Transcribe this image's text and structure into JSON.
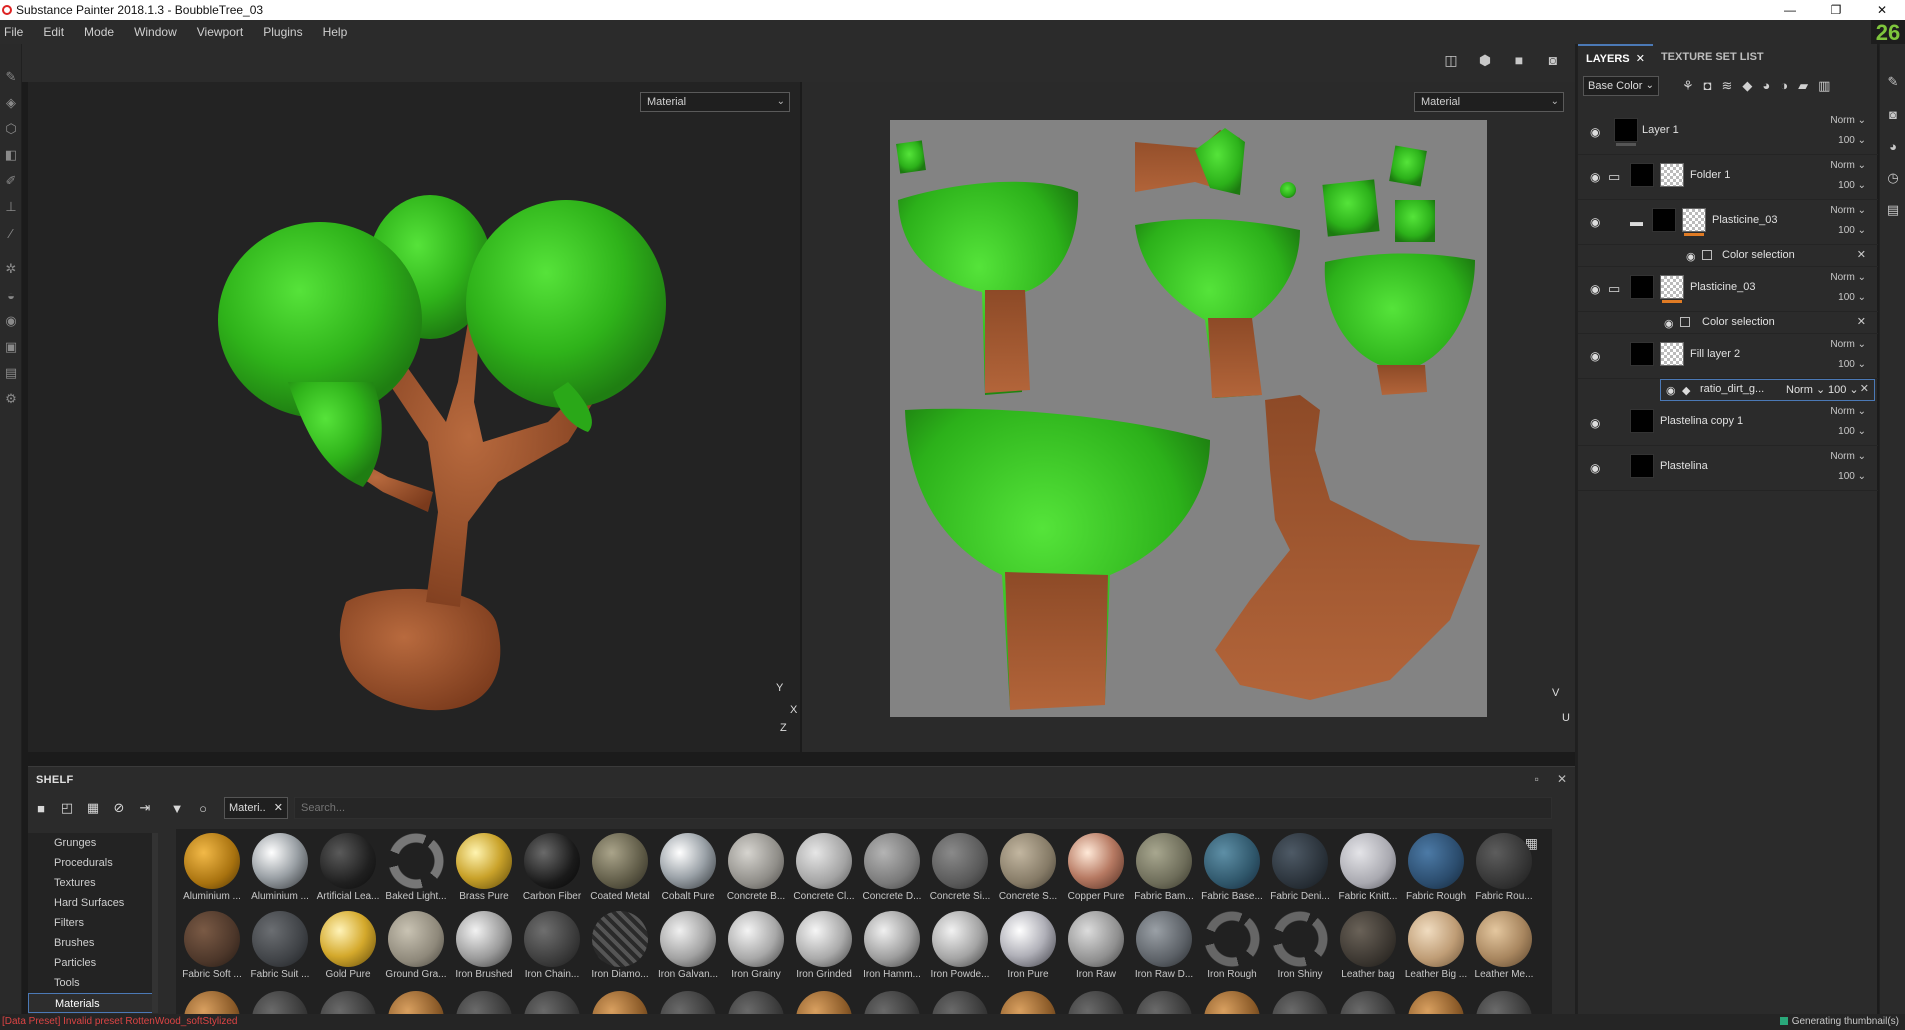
{
  "window": {
    "title": "Substance Painter 2018.1.3 - BoubbleTree_03",
    "controls": [
      "—",
      "❐",
      "✕"
    ]
  },
  "menu": {
    "items": [
      "File",
      "Edit",
      "Mode",
      "Window",
      "Viewport",
      "Plugins",
      "Help"
    ],
    "counter": "26"
  },
  "viewport": {
    "left_select": "Material",
    "right_select": "Material",
    "axis3d": {
      "y": "Y",
      "x": "X",
      "z": "Z"
    },
    "axis2d": {
      "v": "V",
      "u": "U"
    }
  },
  "shelf": {
    "title": "SHELF",
    "filter_chip": "Materi..",
    "filter_close": "✕",
    "search_placeholder": "Search...",
    "categories": [
      "Grunges",
      "Procedurals",
      "Textures",
      "Hard Surfaces",
      "Filters",
      "Brushes",
      "Particles",
      "Tools",
      "Materials"
    ],
    "active_category": "Materials",
    "materials_row1": [
      "Aluminium ...",
      "Aluminium ...",
      "Artificial Lea...",
      "Baked Light...",
      "Brass Pure",
      "Carbon Fiber",
      "Coated Metal",
      "Cobalt Pure",
      "Concrete B...",
      "Concrete Cl...",
      "Concrete D...",
      "Concrete Si...",
      "Concrete S...",
      "Copper Pure",
      "Fabric Bam...",
      "Fabric Base...",
      "Fabric Deni...",
      "Fabric Knitt...",
      "Fabric Rough",
      "Fabric Rou..."
    ],
    "materials_row2": [
      "Fabric Soft ...",
      "Fabric Suit ...",
      "Gold Pure",
      "Ground Gra...",
      "Iron Brushed",
      "Iron Chain...",
      "Iron Diamo...",
      "Iron Galvan...",
      "Iron Grainy",
      "Iron Grinded",
      "Iron Hamm...",
      "Iron Powde...",
      "Iron Pure",
      "Iron Raw",
      "Iron Raw D...",
      "Iron Rough",
      "Iron Shiny",
      "Leather bag",
      "Leather Big ...",
      "Leather Me..."
    ]
  },
  "status": {
    "error": "[Data Preset] Invalid preset RottenWood_softStylized",
    "right": "Generating thumbnail(s)"
  },
  "layers_panel": {
    "tab_layers": "LAYERS",
    "tab_close": "✕",
    "tab_texture_set": "TEXTURE SET LIST",
    "channel": "Base Color",
    "layers": [
      {
        "name": "Layer 1",
        "blend": "Norm",
        "opacity": "100"
      },
      {
        "name": "Folder 1",
        "blend": "Norm",
        "opacity": "100"
      },
      {
        "name": "Plasticine_03",
        "blend": "Norm",
        "opacity": "100"
      },
      {
        "name": "Plasticine_03",
        "blend": "Norm",
        "opacity": "100"
      },
      {
        "name": "Fill layer 2",
        "blend": "Norm",
        "opacity": "100"
      },
      {
        "name": "Plastelina copy 1",
        "blend": "Norm",
        "opacity": "100"
      },
      {
        "name": "Plastelina",
        "blend": "Norm",
        "opacity": "100"
      }
    ],
    "sub_color_selection_1": "Color selection",
    "sub_color_selection_2": "Color selection",
    "sub_fill": {
      "name": "ratio_dirt_g...",
      "blend": "Norm",
      "opacity": "100"
    },
    "remove_glyph": "✕"
  },
  "colors": {
    "accent": "#4b79b6",
    "foliage": "#3fbf1e",
    "trunk": "#a95a34",
    "uv_bg": "#838383",
    "error": "#dd4444"
  }
}
